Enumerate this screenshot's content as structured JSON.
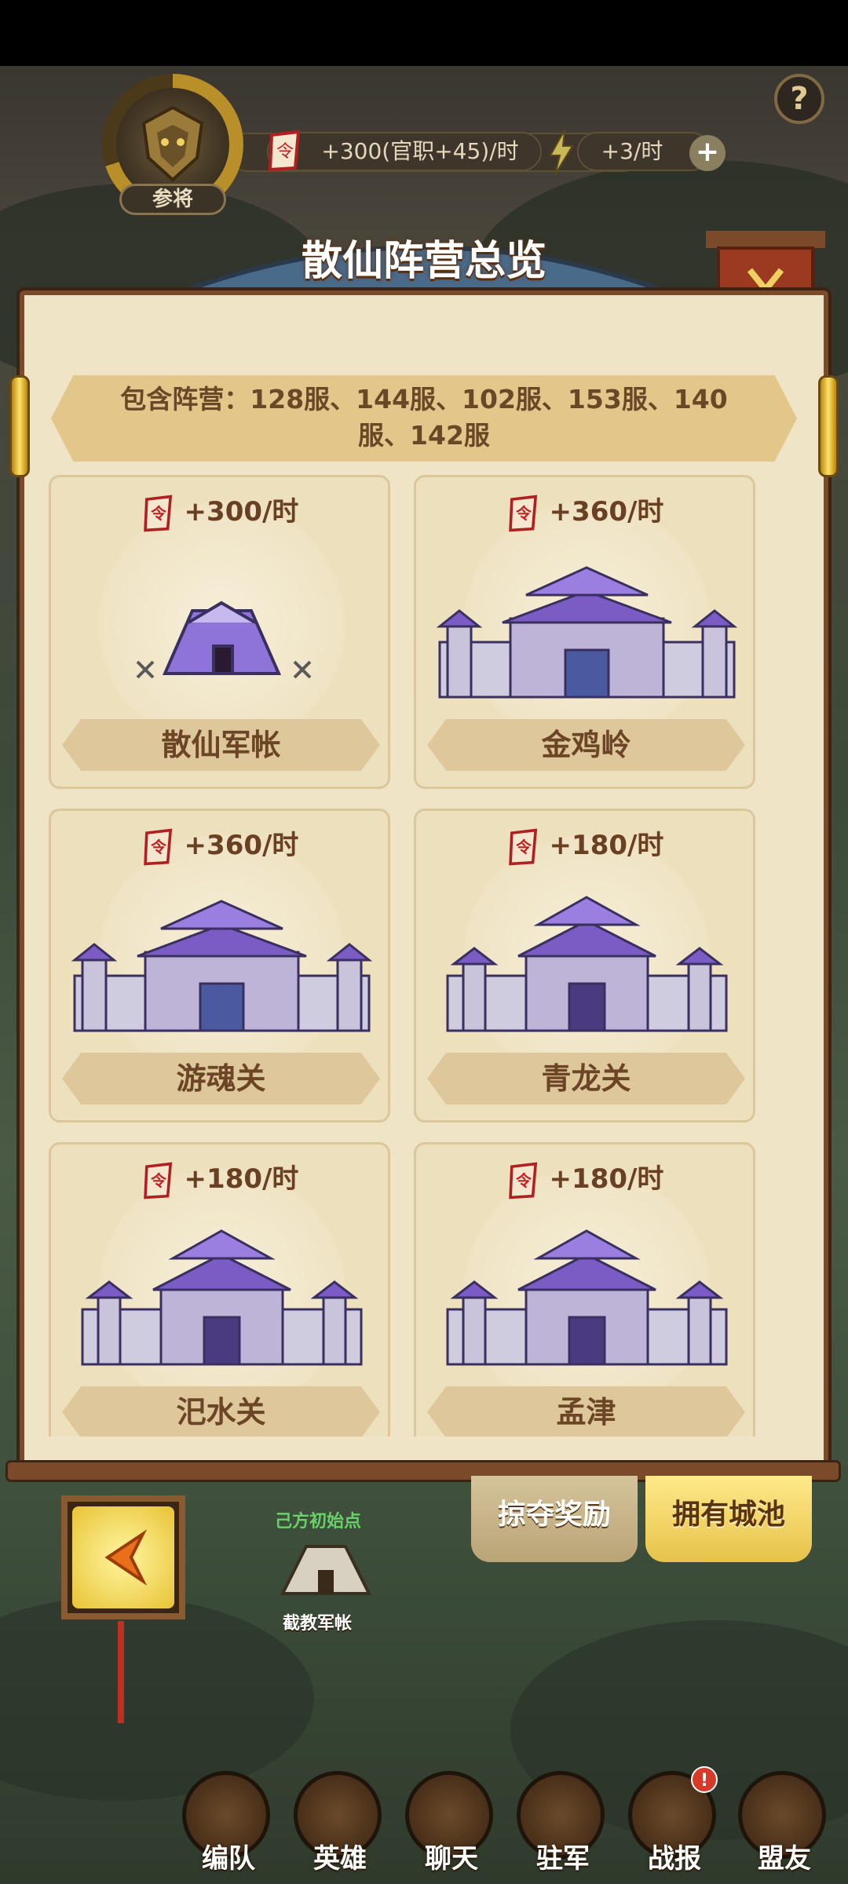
{
  "topbar": {
    "rank": "参将",
    "resource_rate": "+300(官职+45)/时",
    "energy_rate": "+3/时",
    "help": "?"
  },
  "panel": {
    "title": "散仙阵营总览",
    "included_camps": "包含阵营：128服、144服、102服、153服、140服、142服"
  },
  "cards": [
    {
      "rate": "+300/时",
      "name": "散仙军帐",
      "type": "tent"
    },
    {
      "rate": "+360/时",
      "name": "金鸡岭",
      "type": "big-city"
    },
    {
      "rate": "+360/时",
      "name": "游魂关",
      "type": "big-city"
    },
    {
      "rate": "+180/时",
      "name": "青龙关",
      "type": "small-city"
    },
    {
      "rate": "+180/时",
      "name": "汜水关",
      "type": "small-city"
    },
    {
      "rate": "+180/时",
      "name": "孟津",
      "type": "small-city"
    }
  ],
  "tabs": {
    "raid_rewards": "掠夺奖励",
    "owned_cities": "拥有城池"
  },
  "map": {
    "start_point": "己方初始点",
    "enemy_camp": "截教军帐"
  },
  "nav": [
    {
      "label": "编队",
      "icon": "team-icon"
    },
    {
      "label": "英雄",
      "icon": "hero-icon"
    },
    {
      "label": "聊天",
      "icon": "chat-icon"
    },
    {
      "label": "驻军",
      "icon": "garrison-icon"
    },
    {
      "label": "战报",
      "icon": "report-icon"
    },
    {
      "label": "盟友",
      "icon": "ally-icon"
    }
  ],
  "alert_badge": "!",
  "colors": {
    "accent": "#e6c24a",
    "panel": "#f0e4c6",
    "purple": "#7b5cc4"
  }
}
